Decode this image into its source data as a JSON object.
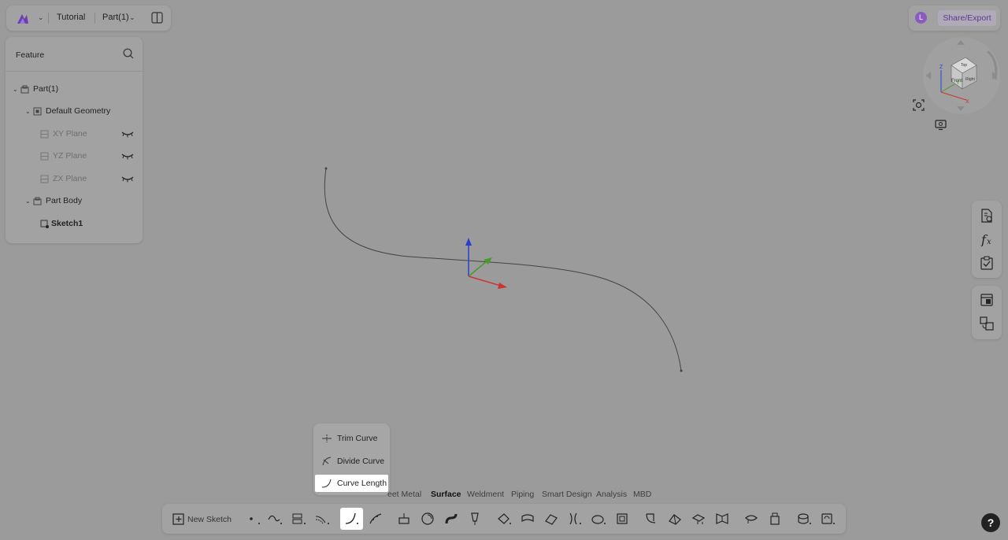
{
  "topbar": {
    "tutorial_label": "Tutorial",
    "part_label": "Part(1)"
  },
  "topright": {
    "avatar_letter": "L",
    "share_label": "Share/Export"
  },
  "feature_panel": {
    "title": "Feature",
    "tree": [
      {
        "label": "Part(1)"
      },
      {
        "label": "Default Geometry"
      },
      {
        "label": "XY Plane"
      },
      {
        "label": "YZ Plane"
      },
      {
        "label": "ZX Plane"
      },
      {
        "label": "Part Body"
      },
      {
        "label": "Sketch1"
      }
    ]
  },
  "viewcube": {
    "faces": [
      "Top",
      "Front",
      "Right"
    ],
    "axes": [
      "Z",
      "Y",
      "X"
    ]
  },
  "flyout": {
    "items": [
      {
        "label": "Trim Curve"
      },
      {
        "label": "Divide Curve"
      },
      {
        "label": "Curve Length"
      }
    ],
    "active_index": 2
  },
  "tabs": [
    {
      "label": "eet Metal"
    },
    {
      "label": "Surface"
    },
    {
      "label": "Weldment"
    },
    {
      "label": "Piping"
    },
    {
      "label": "Smart Design"
    },
    {
      "label": "Analysis"
    },
    {
      "label": "MBD"
    }
  ],
  "active_tab": "Surface",
  "toolbar": {
    "new_sketch_label": "New Sketch"
  },
  "help": {
    "label": "?"
  },
  "colors": {
    "background": "#9b9b9b",
    "accent_purple": "#8a5cc0",
    "axis_x": "#cc3333",
    "axis_y": "#4a9a2a",
    "axis_z": "#2a3fcc"
  }
}
